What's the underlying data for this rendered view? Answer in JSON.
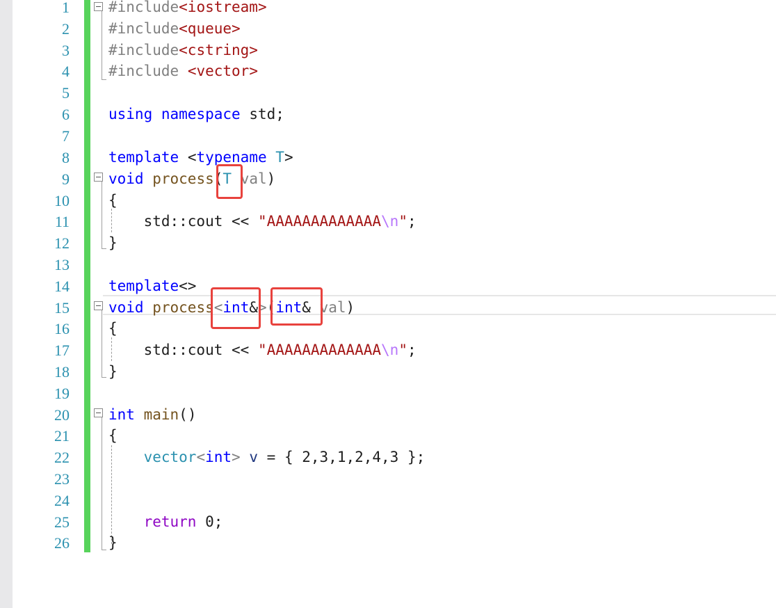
{
  "editor": {
    "line_numbers": [
      "1",
      "2",
      "3",
      "4",
      "5",
      "6",
      "7",
      "8",
      "9",
      "10",
      "11",
      "12",
      "13",
      "14",
      "15",
      "16",
      "17",
      "18",
      "19",
      "20",
      "21",
      "22",
      "23",
      "24",
      "25",
      "26"
    ],
    "tokens": {
      "include": "#include",
      "iostream": "<iostream>",
      "queue": "<queue>",
      "cstring": "<cstring>",
      "vector_hdr": "<vector>",
      "using": "using",
      "namespace": "namespace",
      "std": "std",
      "semicolon": ";",
      "template": "template",
      "template_open": "<",
      "typename": "typename",
      "T": "T",
      "template_close": ">",
      "template_empty": "<>",
      "void": "void",
      "process": "process",
      "lparen": "(",
      "rparen": ")",
      "val": "val",
      "lbrace": "{",
      "rbrace": "}",
      "std_cout": "std::cout",
      "shift": "<<",
      "quote": "\"",
      "string_content": "AAAAAAAAAAAAA",
      "escape_n": "\\n",
      "int": "int",
      "amp": "&",
      "main": "main",
      "parens": "()",
      "vector": "vector",
      "v": "v",
      "equals": "=",
      "init_list": "{ 2,3,1,2,4,3 }",
      "return": "return",
      "zero": "0"
    }
  },
  "colors": {
    "keyword": "#0000ff",
    "control": "#8f08c4",
    "preprocessor": "#808080",
    "string": "#a31515",
    "escape": "#b776fb",
    "function": "#74531f",
    "type": "#2b91af",
    "line_number": "#2b91af",
    "change_bar": "#57d35b",
    "annotation_box": "#e8423d"
  },
  "annotations": {
    "highlight_boxes": [
      "T",
      "int&",
      "int&"
    ]
  }
}
